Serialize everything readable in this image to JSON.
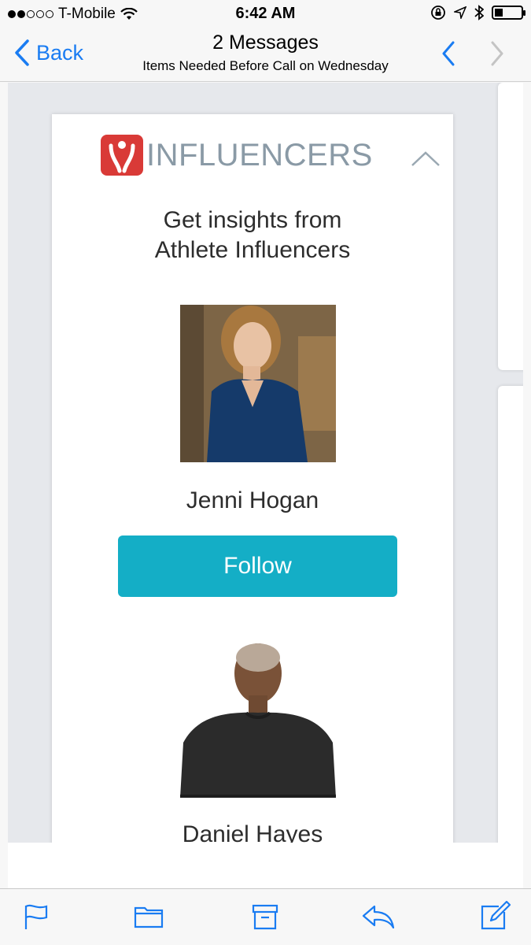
{
  "status_bar": {
    "carrier": "T-Mobile",
    "time": "6:42 AM"
  },
  "nav": {
    "back_label": "Back",
    "title": "2 Messages",
    "subtitle": "Items Needed Before Call on Wednesday"
  },
  "email": {
    "brand_name": "INFLUENCERS",
    "headline_line1": "Get insights from",
    "headline_line2": "Athlete Influencers",
    "influencers": [
      {
        "name": "Jenni Hogan",
        "action": "Follow"
      },
      {
        "name": "Daniel Hayes"
      }
    ]
  },
  "toolbar": {
    "icons": [
      "flag-icon",
      "folder-icon",
      "archive-icon",
      "reply-icon",
      "compose-icon"
    ]
  },
  "colors": {
    "ios_blue": "#1a7cf2",
    "follow_button": "#14aec6",
    "brand_red": "#d93a37",
    "brand_gray": "#8a9aa6"
  }
}
